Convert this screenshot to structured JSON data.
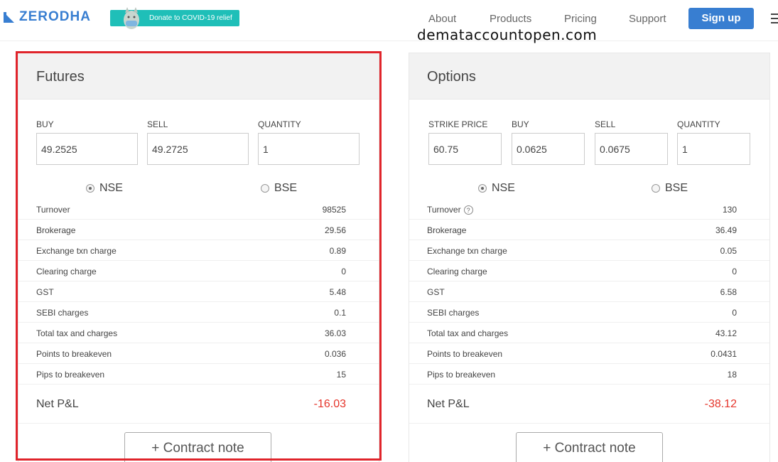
{
  "header": {
    "brand": "ZERODHA",
    "donate_label": "Donate to COVID-19 relief",
    "nav": [
      "About",
      "Products",
      "Pricing",
      "Support"
    ],
    "signup_label": "Sign up",
    "watermark": "demataccountopen.com"
  },
  "futures": {
    "title": "Futures",
    "fields": [
      {
        "label": "BUY",
        "value": "49.2525"
      },
      {
        "label": "SELL",
        "value": "49.2725"
      },
      {
        "label": "QUANTITY",
        "value": "1"
      }
    ],
    "exchanges": [
      {
        "label": "NSE",
        "selected": true
      },
      {
        "label": "BSE",
        "selected": false
      }
    ],
    "rows": [
      {
        "label": "Turnover",
        "value": "98525"
      },
      {
        "label": "Brokerage",
        "value": "29.56"
      },
      {
        "label": "Exchange txn charge",
        "value": "0.89"
      },
      {
        "label": "Clearing charge",
        "value": "0"
      },
      {
        "label": "GST",
        "value": "5.48"
      },
      {
        "label": "SEBI charges",
        "value": "0.1"
      },
      {
        "label": "Total tax and charges",
        "value": "36.03"
      },
      {
        "label": "Points to breakeven",
        "value": "0.036"
      },
      {
        "label": "Pips to breakeven",
        "value": "15"
      }
    ],
    "net_label": "Net P&L",
    "net_value": "-16.03",
    "contract_label": "+ Contract note"
  },
  "options": {
    "title": "Options",
    "fields": [
      {
        "label": "STRIKE PRICE",
        "value": "60.75"
      },
      {
        "label": "BUY",
        "value": "0.0625"
      },
      {
        "label": "SELL",
        "value": "0.0675"
      },
      {
        "label": "QUANTITY",
        "value": "1"
      }
    ],
    "exchanges": [
      {
        "label": "NSE",
        "selected": true
      },
      {
        "label": "BSE",
        "selected": false
      }
    ],
    "turnover_help": "?",
    "rows": [
      {
        "label": "Turnover",
        "value": "130"
      },
      {
        "label": "Brokerage",
        "value": "36.49"
      },
      {
        "label": "Exchange txn charge",
        "value": "0.05"
      },
      {
        "label": "Clearing charge",
        "value": "0"
      },
      {
        "label": "GST",
        "value": "6.58"
      },
      {
        "label": "SEBI charges",
        "value": "0"
      },
      {
        "label": "Total tax and charges",
        "value": "43.12"
      },
      {
        "label": "Points to breakeven",
        "value": "0.0431"
      },
      {
        "label": "Pips to breakeven",
        "value": "18"
      }
    ],
    "net_label": "Net P&L",
    "net_value": "-38.12",
    "contract_label": "+ Contract note"
  },
  "colors": {
    "brand": "#387ed1",
    "donate": "#1fbfb8",
    "loss": "#e5352b",
    "highlight": "#e0242b"
  }
}
